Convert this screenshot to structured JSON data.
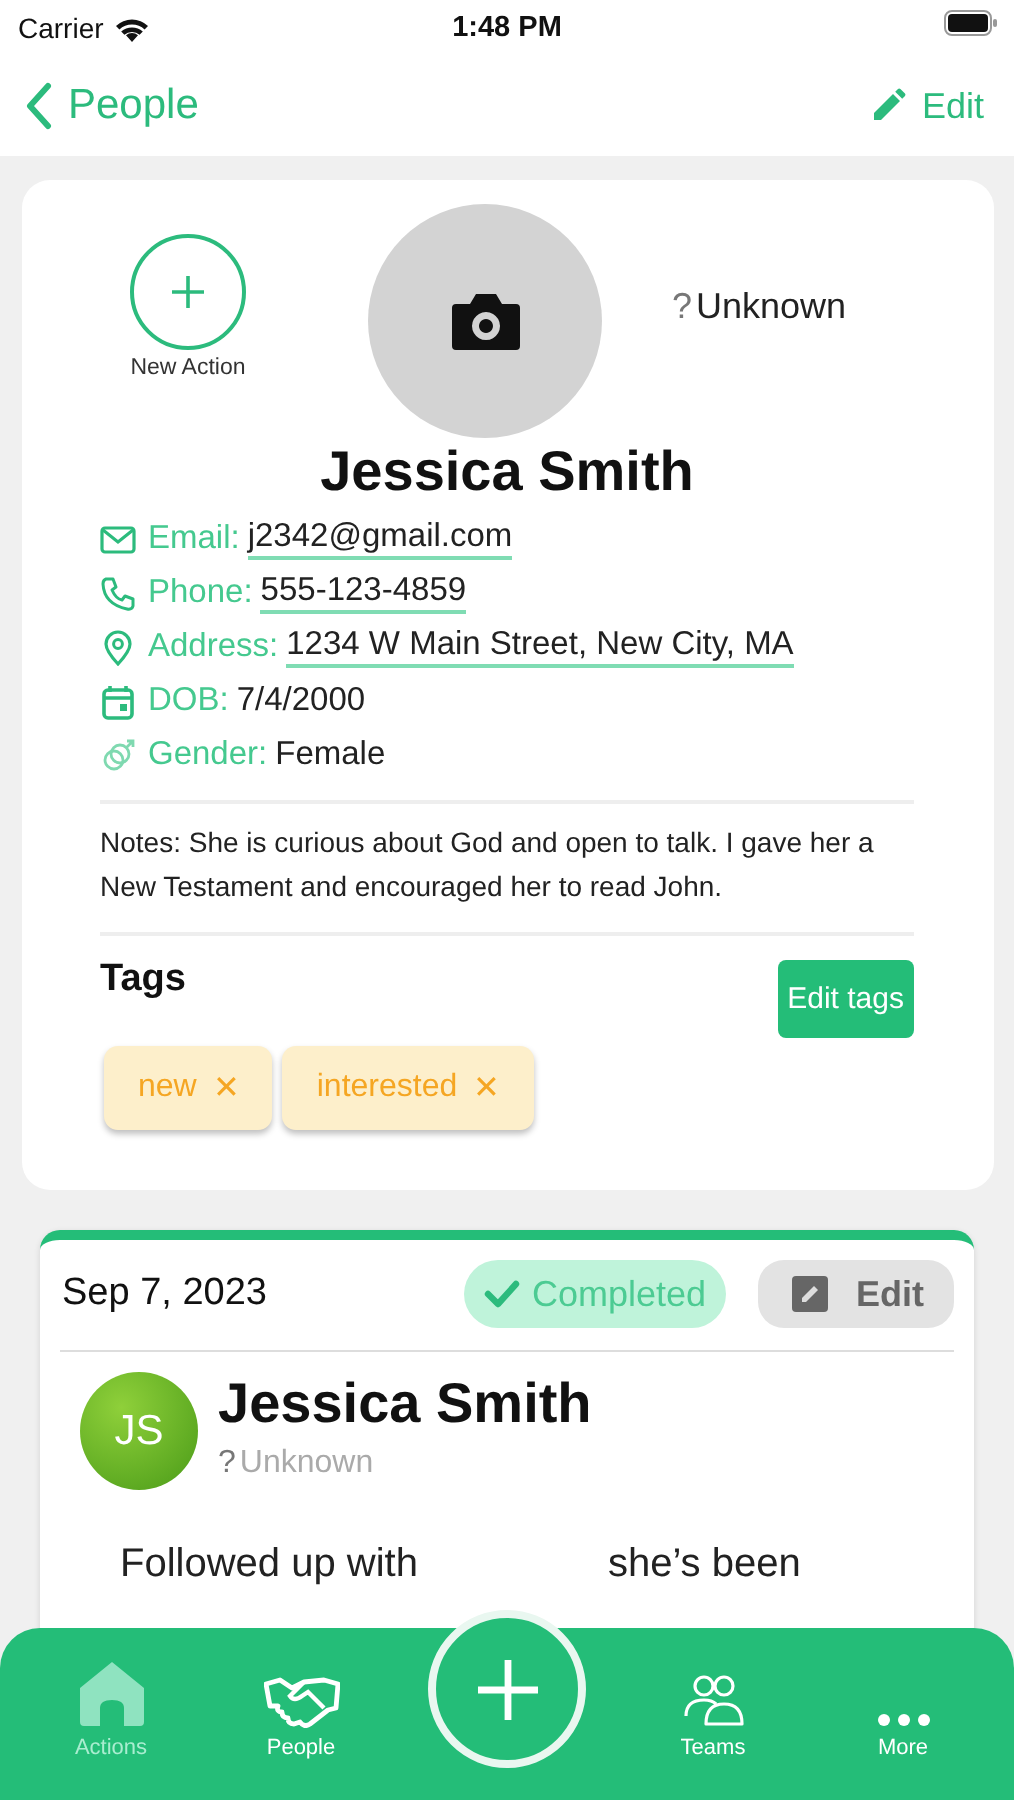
{
  "status_bar": {
    "carrier": "Carrier",
    "time": "1:48 PM"
  },
  "nav": {
    "back": "People",
    "edit": "Edit"
  },
  "profile": {
    "new_action": "New Action",
    "status_mark": "?",
    "status": "Unknown",
    "name": "Jessica Smith",
    "fields": [
      {
        "kind": "link",
        "label": "Email:",
        "value": "j2342@gmail.com"
      },
      {
        "kind": "link",
        "label": "Phone:",
        "value": "555-123-4859"
      },
      {
        "kind": "link",
        "label": "Address:",
        "value": "1234 W Main Street, New City, MA"
      },
      {
        "kind": "text",
        "label": "DOB:",
        "value": "7/4/2000"
      },
      {
        "kind": "text",
        "label": "Gender:",
        "value": "Female"
      }
    ],
    "notes": "Notes: She is curious about God and open to talk. I gave her a New Testament and encouraged her to read John.",
    "tags_title": "Tags",
    "edit_tags": "Edit tags",
    "tags": [
      {
        "label": "new",
        "remove": "✕",
        "color": "#f5a623"
      },
      {
        "label": "interested",
        "remove": "✕",
        "color": "#f5a623"
      }
    ]
  },
  "action": {
    "date": "Sep 7, 2023",
    "status": {
      "label": "Completed",
      "done": true
    },
    "edit": "Edit",
    "initials": "JS",
    "name": "Jessica Smith",
    "status_mark": "?",
    "person_status": "Unknown",
    "note_parts": [
      "Followed up with",
      "she’s been"
    ]
  },
  "tabs": [
    {
      "label": "Actions",
      "selected": true
    },
    {
      "label": "People",
      "selected": false
    },
    {
      "label": "Teams",
      "selected": false
    },
    {
      "label": "More",
      "selected": false
    }
  ]
}
